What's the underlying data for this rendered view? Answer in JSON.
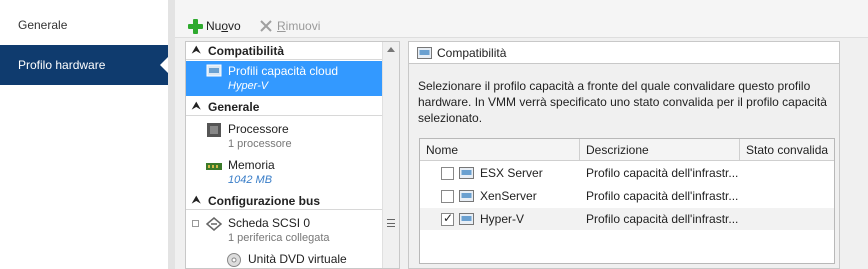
{
  "nav": {
    "items": [
      {
        "label": "Generale"
      },
      {
        "label": "Profilo hardware"
      }
    ]
  },
  "toolbar": {
    "new_label_pre": "Nu",
    "new_label_u": "o",
    "new_label_post": "vo",
    "remove_label_pre": "R",
    "remove_label_u": "i",
    "remove_label_post": "muovi"
  },
  "tree": {
    "sections": [
      {
        "label": "Compatibilità"
      },
      {
        "label": "Generale"
      },
      {
        "label": "Configurazione bus"
      }
    ],
    "items": [
      {
        "title": "Profili capacità cloud",
        "subtitle": "Hyper-V"
      },
      {
        "title": "Processore",
        "subtitle": "1 processore"
      },
      {
        "title": "Memoria",
        "subtitle": "1042 MB"
      },
      {
        "title": "Scheda SCSI 0",
        "subtitle": "1 periferica collegata"
      },
      {
        "title": "Unità DVD virtuale"
      }
    ]
  },
  "detail": {
    "title": "Compatibilità",
    "description": "Selezionare il profilo capacità a fronte del quale convalidare questo profilo hardware. In VMM verrà specificato uno stato convalida per il profilo capacità selezionato.",
    "columns": [
      "Nome",
      "Descrizione",
      "Stato convalida"
    ],
    "rows": [
      {
        "name": "ESX Server",
        "description": "Profilo capacità dell'infrastr...",
        "checked": false
      },
      {
        "name": "XenServer",
        "description": "Profilo capacità dell'infrastr...",
        "checked": false
      },
      {
        "name": "Hyper-V",
        "description": "Profilo capacità dell'infrastr...",
        "checked": true
      }
    ]
  },
  "colors": {
    "nav_active": "#0f3b6e",
    "selection": "#3399ff",
    "add_green": "#2eaa2e"
  }
}
